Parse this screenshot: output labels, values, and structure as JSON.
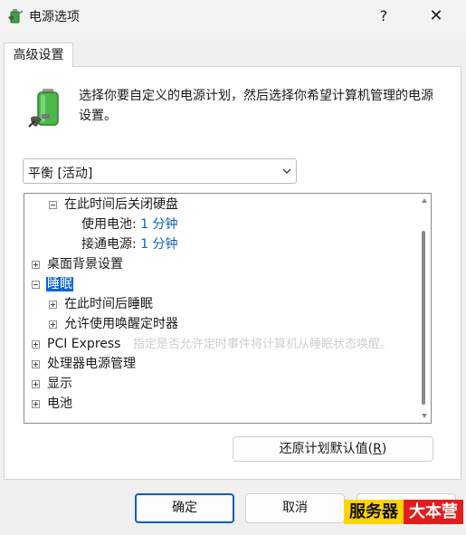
{
  "window": {
    "title": "电源选项",
    "help_glyph": "?",
    "close_glyph": "✕"
  },
  "tabs": [
    {
      "label": "高级设置"
    }
  ],
  "description": "选择你要自定义的电源计划，然后选择你希望计算机管理的电源设置。",
  "plan_select": {
    "value": "平衡 [活动]"
  },
  "tree": {
    "items": [
      {
        "label": "在此时间后关闭硬盘",
        "toggle": "minus"
      },
      {
        "label": "使用电池:",
        "value": "1 分钟"
      },
      {
        "label": "接通电源:",
        "value": "1 分钟"
      },
      {
        "label": "桌面背景设置",
        "toggle": "plus"
      },
      {
        "label": "睡眠",
        "toggle": "minus",
        "selected": true
      },
      {
        "label": "在此时间后睡眠",
        "toggle": "plus"
      },
      {
        "label": "允许使用唤醒定时器",
        "toggle": "plus"
      },
      {
        "label": "PCI Express",
        "toggle": "plus"
      },
      {
        "label": "处理器电源管理",
        "toggle": "plus"
      },
      {
        "label": "显示",
        "toggle": "plus"
      },
      {
        "label": "电池",
        "toggle": "plus"
      }
    ],
    "tooltip_ghost": "指定是否允许定时事件将计算机从睡眠状态唤醒。"
  },
  "restore_button": {
    "label": "还原计划默认值(",
    "accel": "R",
    "suffix": ")"
  },
  "buttons": {
    "ok": "确定",
    "cancel": "取消",
    "apply": ""
  },
  "watermark": {
    "part1": "服务器",
    "part2": "大本营",
    "color1": "#ffd400",
    "color2": "#e51c1c"
  },
  "colors": {
    "accent": "#0a64d8",
    "value_text": "#0b62b9"
  },
  "icons": {
    "app": "power-options-icon",
    "battery": "battery-plug-icon"
  }
}
